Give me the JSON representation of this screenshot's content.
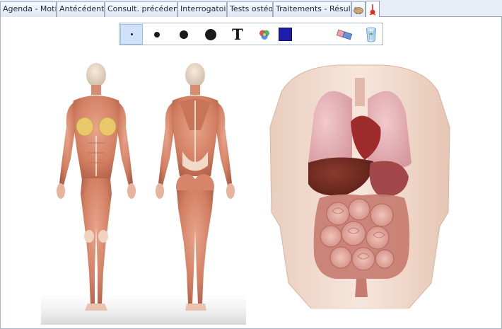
{
  "tabs": [
    {
      "label": "Agenda - Motif"
    },
    {
      "label": "Antécédents"
    },
    {
      "label": "Consult. précédente"
    },
    {
      "label": "Interrogatoire"
    },
    {
      "label": "Tests ostéo."
    },
    {
      "label": "Traitements - Résultat"
    }
  ],
  "icon_tabs": [
    "body-drawing-icon",
    "pin-tool-icon"
  ],
  "toolbar": {
    "tools": [
      "pen-size-tiny",
      "pen-size-small",
      "pen-size-medium",
      "pen-size-large",
      "text-tool",
      "color-picker",
      "current-color",
      "eraser",
      "trash"
    ],
    "text_tool_glyph": "T",
    "current_color": "#1d1da8",
    "selected_tool": "pen-size-tiny"
  },
  "images": {
    "front_figure": "female-muscular-anatomy-front",
    "back_figure": "female-muscular-anatomy-back",
    "torso": "torso-internal-organs"
  }
}
